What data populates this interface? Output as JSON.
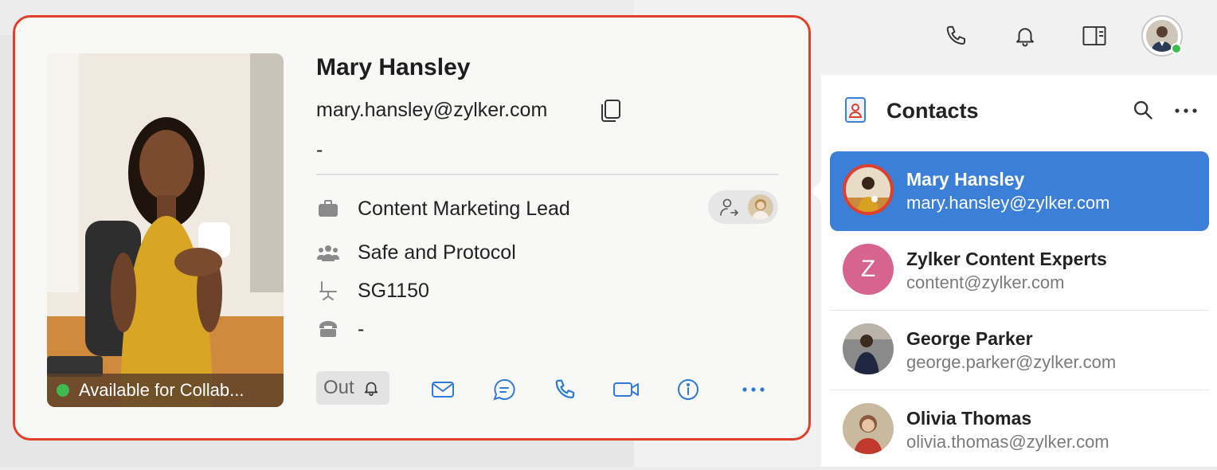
{
  "toolbar": {
    "icons": [
      "phone-icon",
      "bell-icon",
      "panel-icon",
      "user-avatar"
    ],
    "user_status_color": "#3fb950"
  },
  "contacts": {
    "title": "Contacts",
    "items": [
      {
        "name": "Mary Hansley",
        "email": "mary.hansley@zylker.com",
        "selected": true
      },
      {
        "name": "Zylker Content Experts",
        "email": "content@zylker.com",
        "initial": "Z",
        "avatar_color": "#d6648f"
      },
      {
        "name": "George Parker",
        "email": "george.parker@zylker.com"
      },
      {
        "name": "Olivia Thomas",
        "email": "olivia.thomas@zylker.com"
      }
    ]
  },
  "profile": {
    "name": "Mary Hansley",
    "email": "mary.hansley@zylker.com",
    "phone": "-",
    "designation": "Content Marketing Lead",
    "department": "Safe and Protocol",
    "seat": "SG1150",
    "extension": "-",
    "status": "Available for Collab...",
    "status_color": "#3fb950",
    "out_label": "Out"
  },
  "actions": [
    "mail-icon",
    "chat-icon",
    "phone-icon",
    "video-icon",
    "info-icon",
    "more-icon"
  ],
  "colors": {
    "accent": "#3b7fd9",
    "card_border": "#e0402b",
    "action_blue": "#2f7ad6"
  }
}
